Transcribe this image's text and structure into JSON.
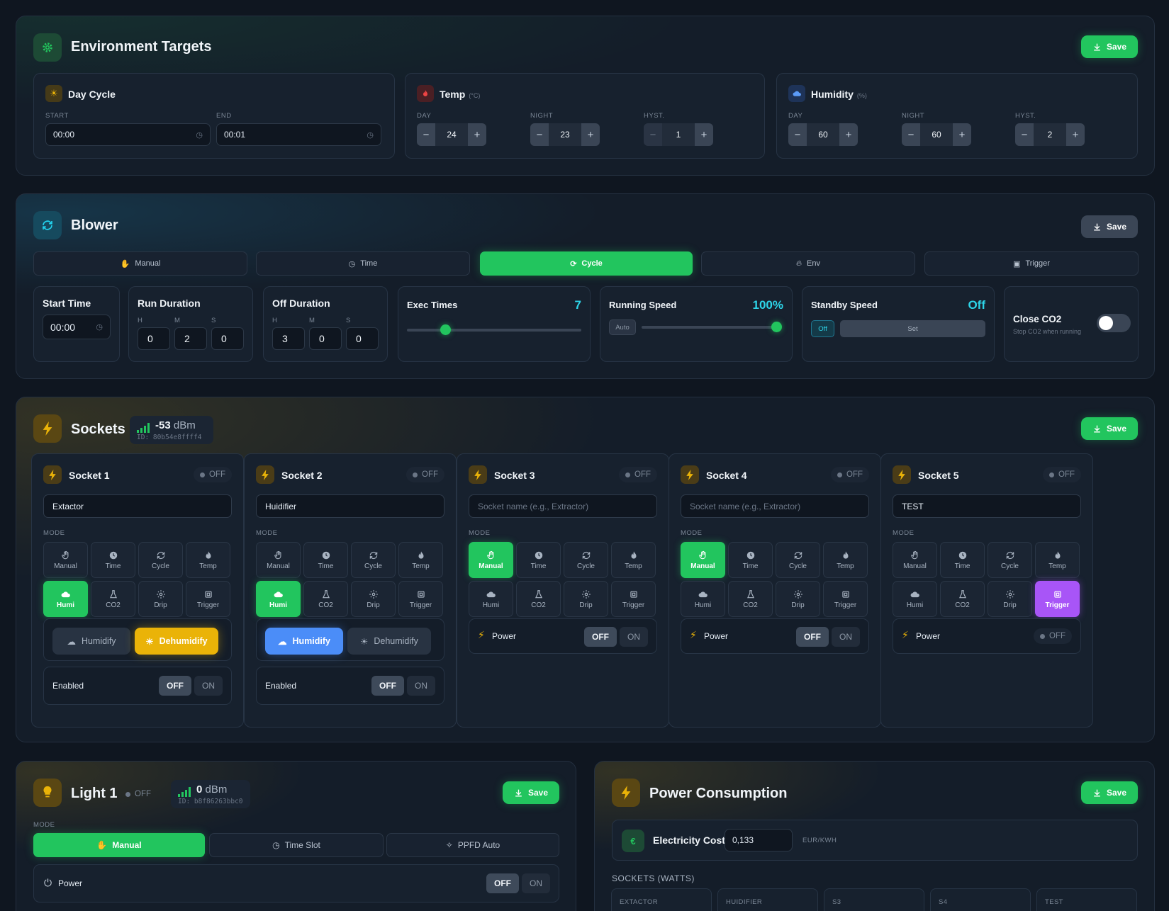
{
  "env": {
    "title": "Environment Targets",
    "save": "Save",
    "day_cycle": {
      "title": "Day Cycle",
      "start_label": "START",
      "end_label": "END",
      "start": "00:00",
      "end": "00:01"
    },
    "temp": {
      "title": "Temp",
      "unit": "(°C)",
      "day_label": "DAY",
      "night_label": "NIGHT",
      "hyst_label": "HYST.",
      "day": "24",
      "night": "23",
      "hyst": "1"
    },
    "humidity": {
      "title": "Humidity",
      "unit": "(%)",
      "day_label": "DAY",
      "night_label": "NIGHT",
      "hyst_label": "HYST.",
      "day": "60",
      "night": "60",
      "hyst": "2"
    }
  },
  "blower": {
    "title": "Blower",
    "save": "Save",
    "tabs": [
      {
        "label": "Manual"
      },
      {
        "label": "Time"
      },
      {
        "label": "Cycle"
      },
      {
        "label": "Env"
      },
      {
        "label": "Trigger"
      }
    ],
    "active_tab": "Cycle",
    "start_time": {
      "label": "Start Time",
      "value": "00:00"
    },
    "run_duration": {
      "label": "Run Duration",
      "h_label": "H",
      "m_label": "M",
      "s_label": "S",
      "h": "0",
      "m": "2",
      "s": "0"
    },
    "off_duration": {
      "label": "Off Duration",
      "h_label": "H",
      "m_label": "M",
      "s_label": "S",
      "h": "3",
      "m": "0",
      "s": "0"
    },
    "exec_times": {
      "label": "Exec Times",
      "value": "7",
      "level": 0.22
    },
    "running_speed": {
      "label": "Running Speed",
      "value": "100%",
      "auto_label": "Auto",
      "level": 1.0
    },
    "standby_speed": {
      "label": "Standby Speed",
      "value": "Off",
      "off_label": "Off",
      "set_label": "Set"
    },
    "close_co2": {
      "label": "Close CO2",
      "hint": "Stop CO2 when running",
      "enabled": false
    }
  },
  "sockets": {
    "title": "Sockets",
    "signal": "-53",
    "signal_unit": "dBm",
    "device_id": "ID: 80b54e8ffff4",
    "save": "Save",
    "mode_label": "MODE",
    "placeholder": "Socket name (e.g., Extractor)",
    "mode_names": [
      "Manual",
      "Time",
      "Cycle",
      "Temp",
      "Humi",
      "CO2",
      "Drip",
      "Trigger"
    ],
    "items": [
      {
        "title": "Socket 1",
        "status": "OFF",
        "name": "Extactor",
        "active_mode": "Humi",
        "humidify": "Humidify",
        "dehumidify": "Dehumidify",
        "enabled_label": "Enabled",
        "off": "OFF",
        "on": "ON"
      },
      {
        "title": "Socket 2",
        "status": "OFF",
        "name": "Huidifier",
        "active_mode": "Humi",
        "humidify": "Humidify",
        "dehumidify": "Dehumidify",
        "enabled_label": "Enabled",
        "off": "OFF",
        "on": "ON"
      },
      {
        "title": "Socket 3",
        "status": "OFF",
        "name": "",
        "active_mode": "Manual",
        "power_label": "Power",
        "off": "OFF",
        "on": "ON"
      },
      {
        "title": "Socket 4",
        "status": "OFF",
        "name": "",
        "active_mode": "Manual",
        "power_label": "Power",
        "off": "OFF",
        "on": "ON"
      },
      {
        "title": "Socket 5",
        "status": "OFF",
        "name": "TEST",
        "active_mode": "Trigger",
        "power_label": "Power",
        "power_status": "OFF"
      }
    ]
  },
  "light": {
    "title": "Light 1",
    "status": "OFF",
    "signal": "0",
    "signal_unit": "dBm",
    "device_id": "ID: b8f86263bbc0",
    "save": "Save",
    "mode_label": "MODE",
    "modes": [
      {
        "label": "Manual"
      },
      {
        "label": "Time Slot"
      },
      {
        "label": "PPFD Auto"
      }
    ],
    "active_mode": "Manual",
    "power_label": "Power",
    "off": "OFF",
    "on": "ON"
  },
  "power": {
    "title": "Power Consumption",
    "save": "Save",
    "cost_label": "Electricity Cost",
    "currency_symbol": "€",
    "cost_value": "0,133",
    "cost_unit": "EUR/KWH",
    "sockets_heading": "SOCKETS (WATTS)",
    "columns": [
      "EXTACTOR",
      "HUIDIFIER",
      "S3",
      "S4",
      "TEST"
    ]
  },
  "colors": {
    "accent": "#22c55e",
    "bg": "#0f1620",
    "card": "#141d29",
    "cyan": "#2dd4e8",
    "amber": "#eab308",
    "blue": "#4b8df8",
    "purple": "#a855f7"
  }
}
